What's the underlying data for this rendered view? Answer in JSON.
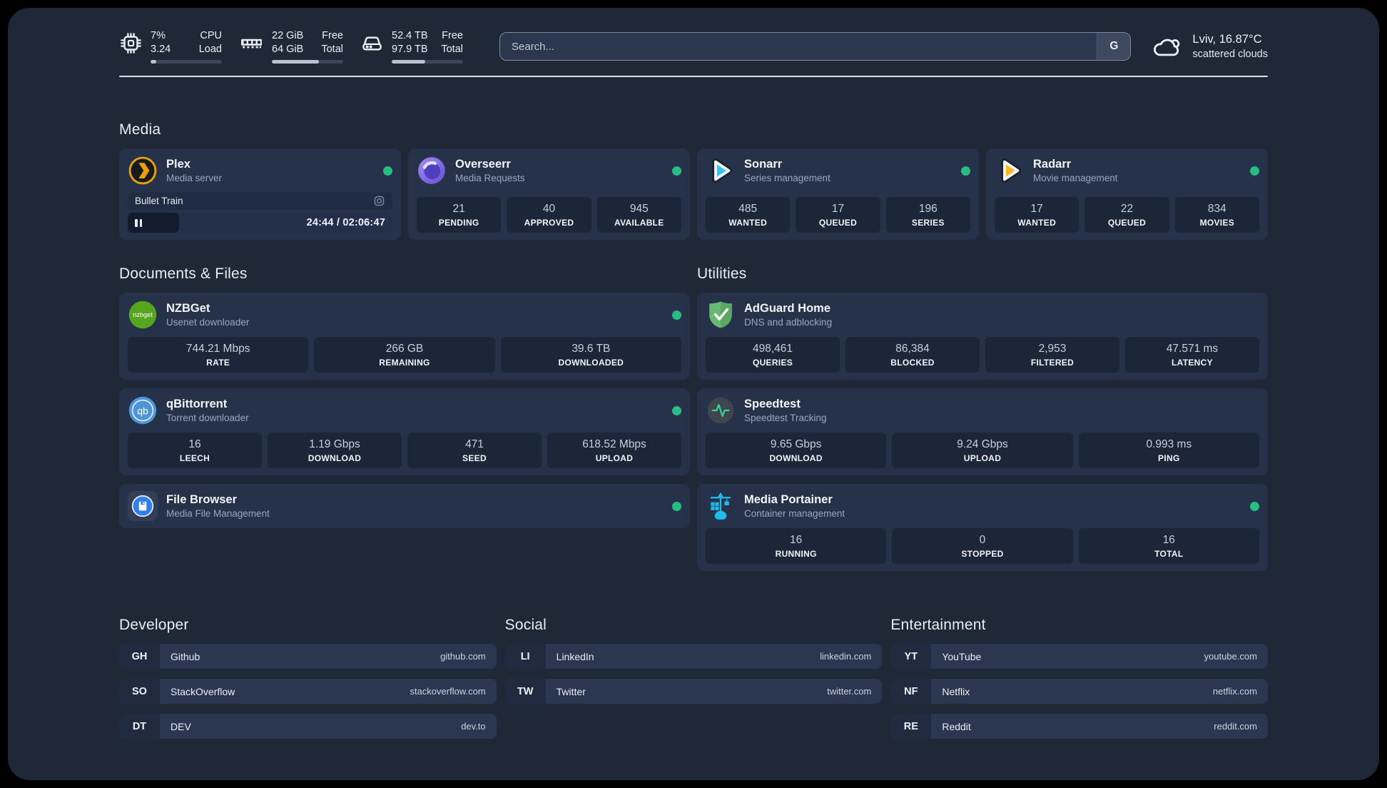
{
  "topbar": {
    "cpu": {
      "value_top": "7%",
      "value_bottom": "3.24",
      "label_top": "CPU",
      "label_bottom": "Load",
      "bar_percent": "8%"
    },
    "memory": {
      "value_top": "22 GiB",
      "value_bottom": "64 GiB",
      "label_top": "Free",
      "label_bottom": "Total",
      "bar_percent": "66%"
    },
    "disk": {
      "value_top": "52.4 TB",
      "value_bottom": "97.9 TB",
      "label_top": "Free",
      "label_bottom": "Total",
      "bar_percent": "47%"
    },
    "search": {
      "placeholder": "Search...",
      "provider": "G"
    },
    "weather": {
      "location": "Lviv, 16.87°C",
      "condition": "scattered clouds"
    }
  },
  "sections": {
    "media": {
      "title": "Media"
    },
    "documents": {
      "title": "Documents & Files"
    },
    "utilities": {
      "title": "Utilities"
    },
    "developer": {
      "title": "Developer"
    },
    "social": {
      "title": "Social"
    },
    "entertainment": {
      "title": "Entertainment"
    }
  },
  "services": {
    "plex": {
      "name": "Plex",
      "subtitle": "Media server",
      "online": true,
      "now_playing": {
        "title": "Bullet Train",
        "time": "24:44 / 02:06:47",
        "progress_percent": "19.5%"
      }
    },
    "overseerr": {
      "name": "Overseerr",
      "subtitle": "Media Requests",
      "online": true,
      "stats": [
        {
          "value": "21",
          "label": "PENDING"
        },
        {
          "value": "40",
          "label": "APPROVED"
        },
        {
          "value": "945",
          "label": "AVAILABLE"
        }
      ]
    },
    "sonarr": {
      "name": "Sonarr",
      "subtitle": "Series management",
      "online": true,
      "stats": [
        {
          "value": "485",
          "label": "WANTED"
        },
        {
          "value": "17",
          "label": "QUEUED"
        },
        {
          "value": "196",
          "label": "SERIES"
        }
      ]
    },
    "radarr": {
      "name": "Radarr",
      "subtitle": "Movie management",
      "online": true,
      "stats": [
        {
          "value": "17",
          "label": "WANTED"
        },
        {
          "value": "22",
          "label": "QUEUED"
        },
        {
          "value": "834",
          "label": "MOVIES"
        }
      ]
    },
    "nzbget": {
      "name": "NZBGet",
      "subtitle": "Usenet downloader",
      "online": true,
      "logo_text": "nzbget",
      "stats": [
        {
          "value": "744.21 Mbps",
          "label": "RATE"
        },
        {
          "value": "266 GB",
          "label": "REMAINING"
        },
        {
          "value": "39.6 TB",
          "label": "DOWNLOADED"
        }
      ]
    },
    "qbittorrent": {
      "name": "qBittorrent",
      "subtitle": "Torrent downloader",
      "online": true,
      "logo_text": "qb",
      "stats": [
        {
          "value": "16",
          "label": "LEECH"
        },
        {
          "value": "1.19 Gbps",
          "label": "DOWNLOAD"
        },
        {
          "value": "471",
          "label": "SEED"
        },
        {
          "value": "618.52 Mbps",
          "label": "UPLOAD"
        }
      ]
    },
    "filebrowser": {
      "name": "File Browser",
      "subtitle": "Media File Management",
      "online": true
    },
    "adguard": {
      "name": "AdGuard Home",
      "subtitle": "DNS and adblocking",
      "online": false,
      "stats": [
        {
          "value": "498,461",
          "label": "QUERIES"
        },
        {
          "value": "86,384",
          "label": "BLOCKED"
        },
        {
          "value": "2,953",
          "label": "FILTERED"
        },
        {
          "value": "47.571 ms",
          "label": "LATENCY"
        }
      ]
    },
    "speedtest": {
      "name": "Speedtest",
      "subtitle": "Speedtest Tracking",
      "online": false,
      "stats": [
        {
          "value": "9.65 Gbps",
          "label": "DOWNLOAD"
        },
        {
          "value": "9.24 Gbps",
          "label": "UPLOAD"
        },
        {
          "value": "0.993 ms",
          "label": "PING"
        }
      ]
    },
    "portainer": {
      "name": "Media Portainer",
      "subtitle": "Container management",
      "online": true,
      "stats": [
        {
          "value": "16",
          "label": "RUNNING"
        },
        {
          "value": "0",
          "label": "STOPPED"
        },
        {
          "value": "16",
          "label": "TOTAL"
        }
      ]
    }
  },
  "bookmarks": {
    "developer": [
      {
        "abbr": "GH",
        "name": "Github",
        "domain": "github.com"
      },
      {
        "abbr": "SO",
        "name": "StackOverflow",
        "domain": "stackoverflow.com"
      },
      {
        "abbr": "DT",
        "name": "DEV",
        "domain": "dev.to"
      }
    ],
    "social": [
      {
        "abbr": "LI",
        "name": "LinkedIn",
        "domain": "linkedin.com"
      },
      {
        "abbr": "TW",
        "name": "Twitter",
        "domain": "twitter.com"
      }
    ],
    "entertainment": [
      {
        "abbr": "YT",
        "name": "YouTube",
        "domain": "youtube.com"
      },
      {
        "abbr": "NF",
        "name": "Netflix",
        "domain": "netflix.com"
      },
      {
        "abbr": "RE",
        "name": "Reddit",
        "domain": "reddit.com"
      }
    ]
  },
  "colors": {
    "status_online": "#2abd82",
    "page_background": "#1e2837",
    "card_background": "#26324a",
    "plex_accent": "#e5a00d",
    "overseerr_purple": "#7b68ee",
    "sonarr_cyan": "#35c5f4",
    "radarr_orange": "#ffb822",
    "nzbget_green": "#55a51f",
    "qbittorrent_blue": "#4f94d4",
    "filebrowser_blue": "#2f80ed",
    "adguard_green": "#63b568",
    "speedtest_pulse": "#34d399",
    "portainer_blue": "#20b9e8"
  }
}
